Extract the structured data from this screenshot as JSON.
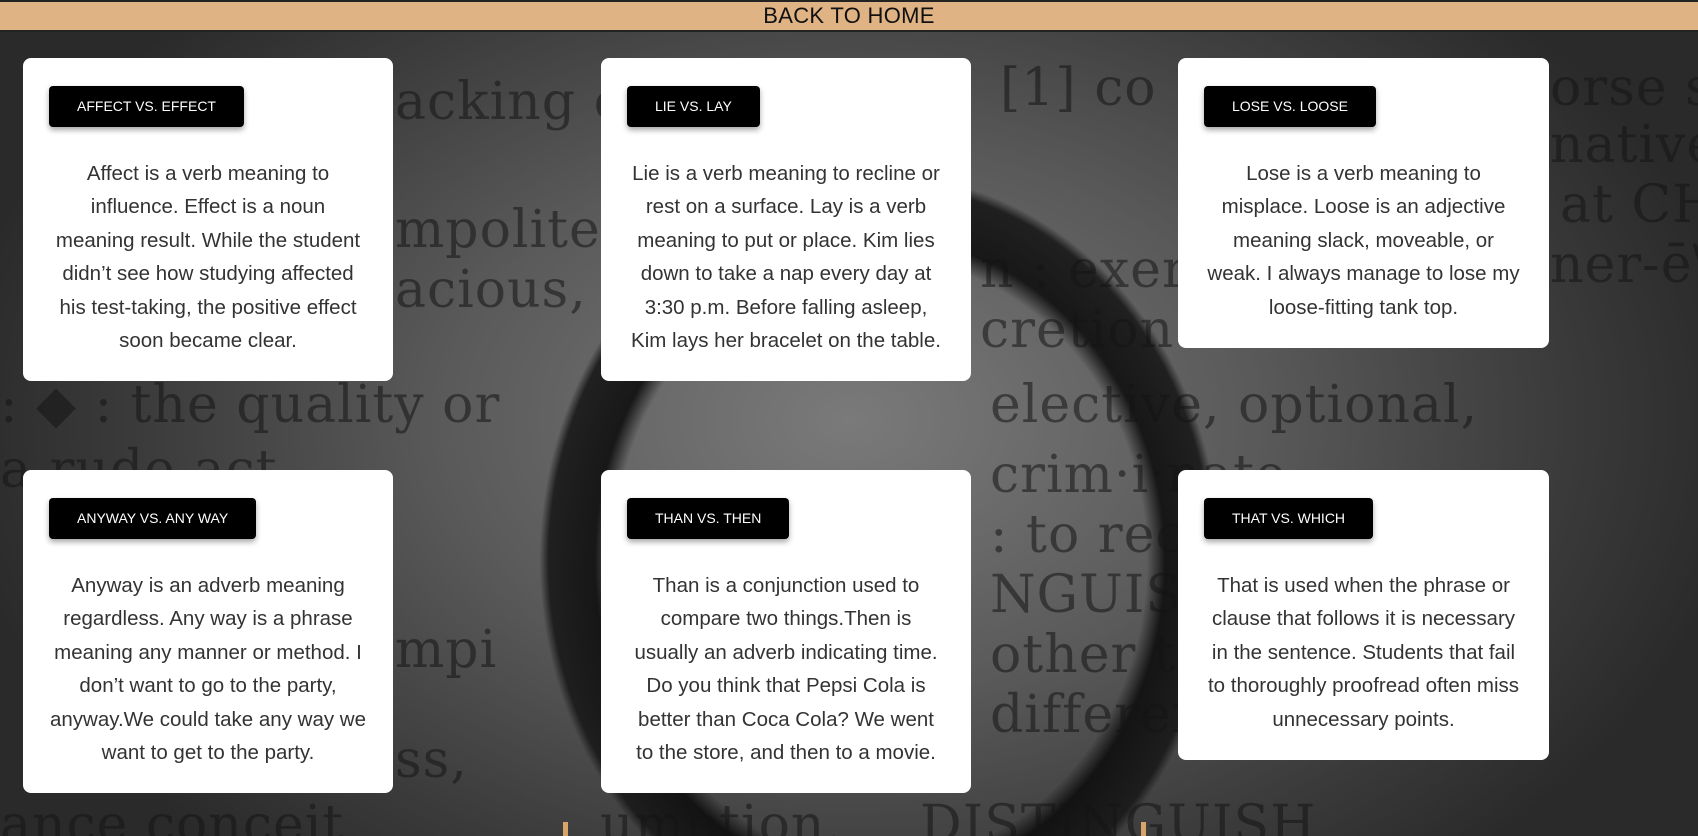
{
  "nav": {
    "back_home": "BACK TO HOME"
  },
  "cards": [
    {
      "tag": "AFFECT VS. EFFECT",
      "text": "Affect is a verb meaning to influence. Effect is a noun meaning result. While the student didn’t see how studying affected his test-taking, the positive effect soon became clear."
    },
    {
      "tag": "LIE VS. LAY",
      "text": "Lie is a verb meaning to recline or rest on a surface. Lay is a verb meaning to put or place. Kim lies down to take a nap every day at 3:30 p.m. Before falling asleep, Kim lays her bracelet on the table."
    },
    {
      "tag": "LOSE VS. LOOSE",
      "text": "Lose is a verb meaning to misplace. Loose is an adjective meaning slack, moveable, or weak. I always manage to lose my loose-fitting tank top."
    },
    {
      "tag": "ANYWAY VS. ANY WAY",
      "text": "Anyway is an adverb meaning regardless. Any way is a phrase meaning any manner or method. I don’t want to go to the party, anyway.We could take any way we want to get to the party."
    },
    {
      "tag": "THAN VS. THEN",
      "text": "Than is a conjunction used to compare two things.Then is usually an adverb indicating time. Do you think that Pepsi Cola is better than Coca Cola? We went to the store, and then to a movie."
    },
    {
      "tag": "THAT VS. WHICH",
      "text": "That is used when the phrase or clause that follows it is necessary in the sentence. Students that fail to thoroughly proofread often miss unnecessary points."
    }
  ],
  "colors": {
    "nav_bg": "#dfb384",
    "tag_bg": "#000000",
    "card_bg": "#ffffff"
  }
}
